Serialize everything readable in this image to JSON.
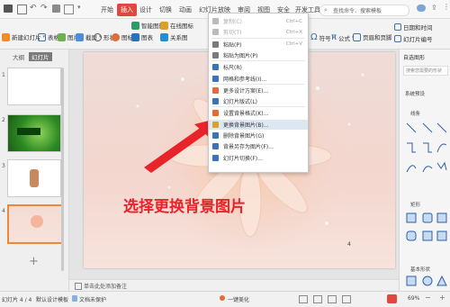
{
  "tabs": [
    "开始",
    "插入",
    "设计",
    "切换",
    "动画",
    "幻灯片放映",
    "审阅",
    "视图",
    "安全",
    "开发工具",
    "特色功能"
  ],
  "active_tab": "插入",
  "search_placeholder": "查找命令、搜索模板",
  "ribbon_left": [
    "新建幻灯片",
    "表格",
    "图片",
    "截屏",
    "形状",
    "图标",
    "智能图形",
    "图表",
    "关系图",
    "在线图标"
  ],
  "ribbon_right": [
    "符号",
    "公式",
    "页眉和页脚",
    "日期和时间",
    "幻灯片编号"
  ],
  "left_panel": {
    "tab_outline": "大纲",
    "tab_slides": "幻灯片",
    "slide_numbers": [
      "1",
      "2",
      "3",
      "4"
    ]
  },
  "context_menu": [
    {
      "label": "复制(C)",
      "shortcut": "Ctrl+C",
      "disabled": true
    },
    {
      "label": "剪切(T)",
      "shortcut": "Ctrl+X",
      "disabled": true
    },
    {
      "label": "粘贴(P)",
      "shortcut": "Ctrl+V",
      "disabled": false
    },
    {
      "label": "粘贴为图片(P)",
      "shortcut": "",
      "disabled": false
    },
    {
      "label": "标尺(R)",
      "shortcut": "",
      "disabled": false
    },
    {
      "label": "网格和参考线(I)...",
      "shortcut": "",
      "disabled": false
    },
    {
      "label": "更多设计方案(E)...",
      "shortcut": "",
      "disabled": false
    },
    {
      "label": "幻灯片版式(L)",
      "shortcut": "",
      "disabled": false
    },
    {
      "label": "设置背景格式(K)...",
      "shortcut": "",
      "disabled": false
    },
    {
      "label": "更换背景图片(B)...",
      "shortcut": "",
      "disabled": false,
      "highlight": true
    },
    {
      "label": "删除背景图片(G)",
      "shortcut": "",
      "disabled": false
    },
    {
      "label": "背景另存为图片(F)...",
      "shortcut": "",
      "disabled": false
    },
    {
      "label": "幻灯片切换(F)...",
      "shortcut": "",
      "disabled": false
    }
  ],
  "caption": "选择更换背景图片",
  "slide_page_number": "4",
  "right_panel": {
    "title": "自选图形",
    "search": "搜索您需要的形状",
    "preset": "系统预设",
    "section_lines": "线条",
    "section_rect": "矩形",
    "section_basic": "基本形状"
  },
  "notes_placeholder": "单击此处添加备注",
  "status": {
    "slide_info": "幻灯片 4 / 4",
    "theme": "默认设计模板",
    "protect": "文档未保护",
    "beautify": "一键美化",
    "zoom": "69%"
  },
  "colors": {
    "accent": "#e0483f",
    "caption": "#e8232a",
    "highlight": "#dde7f2"
  }
}
